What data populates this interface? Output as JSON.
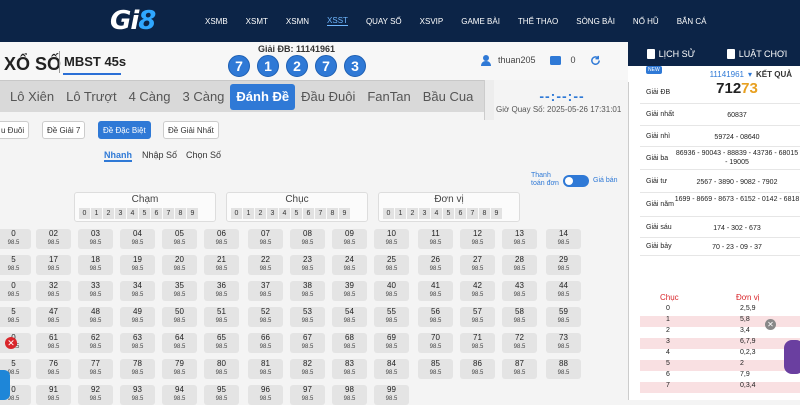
{
  "header": {
    "logo": "Gi8",
    "nav": [
      "XSMB",
      "XSMT",
      "XSMN",
      "XSST",
      "QUAY SỐ",
      "XSVIP",
      "GAME BÀI",
      "THỂ THAO",
      "SÒNG BÀI",
      "NỔ HŨ",
      "BẮN CÁ"
    ],
    "active_nav": "XSST"
  },
  "game": {
    "title": "XỔ SỐ",
    "name": "MBST 45s",
    "special_label": "Giải ĐB: 11141961",
    "balls": [
      "7",
      "1",
      "2",
      "7",
      "3"
    ],
    "user": "thuan205",
    "balance": "0"
  },
  "tabs": [
    "Lô Xiên",
    "Lô Trượt",
    "4 Càng",
    "3 Càng",
    "Đánh Đề",
    "Đầu Đuôi",
    "FanTan",
    "Bầu Cua"
  ],
  "active_tab": "Đánh Đề",
  "timer": "--:--:--",
  "draw_time": "Giờ Quay Số: 2025-05-26 17:31:01",
  "sub_tabs": [
    "u Đuôi",
    "Đề Giải 7",
    "Đề Đặc Biệt",
    "Đề Giải Nhất"
  ],
  "modes": [
    "Nhanh",
    "Nhập Số",
    "Chọn Số"
  ],
  "toggle": {
    "left": "Thanh toán đơn",
    "right": "Giá bán"
  },
  "digit_groups": [
    {
      "title": "Chạm",
      "digits": [
        "0",
        "1",
        "2",
        "3",
        "4",
        "5",
        "6",
        "7",
        "8",
        "9"
      ]
    },
    {
      "title": "Chục",
      "digits": [
        "0",
        "1",
        "2",
        "3",
        "4",
        "5",
        "6",
        "7",
        "8",
        "9"
      ]
    },
    {
      "title": "Đơn vị",
      "digits": [
        "0",
        "1",
        "2",
        "3",
        "4",
        "5",
        "6",
        "7",
        "8",
        "9"
      ]
    }
  ],
  "odds": "98.5",
  "grid_rows": [
    [
      "0",
      "02",
      "03",
      "04",
      "05",
      "06",
      "07",
      "08",
      "09",
      "10",
      "11",
      "12",
      "13",
      "14"
    ],
    [
      "5",
      "17",
      "18",
      "19",
      "20",
      "21",
      "22",
      "23",
      "24",
      "25",
      "26",
      "27",
      "28",
      "29"
    ],
    [
      "0",
      "32",
      "33",
      "34",
      "35",
      "36",
      "37",
      "38",
      "39",
      "40",
      "41",
      "42",
      "43",
      "44"
    ],
    [
      "5",
      "47",
      "48",
      "49",
      "50",
      "51",
      "52",
      "53",
      "54",
      "55",
      "56",
      "57",
      "58",
      "59"
    ],
    [
      "0",
      "61",
      "62",
      "63",
      "64",
      "65",
      "66",
      "67",
      "68",
      "69",
      "70",
      "71",
      "72",
      "73"
    ],
    [
      "5",
      "76",
      "77",
      "78",
      "79",
      "80",
      "81",
      "82",
      "83",
      "84",
      "85",
      "86",
      "87",
      "88"
    ],
    [
      "0",
      "91",
      "92",
      "93",
      "94",
      "95",
      "96",
      "97",
      "98",
      "99"
    ]
  ],
  "right": {
    "tabs": [
      "LỊCH SỬ",
      "LUẬT CHƠI"
    ],
    "new": "NEW",
    "period": "11141961",
    "result_label": "KẾT QUẢ",
    "prizes": [
      {
        "label": "Giải ĐB",
        "value": "71273"
      },
      {
        "label": "Giải nhất",
        "value": "60837"
      },
      {
        "label": "Giải nhì",
        "value": "59724 - 08640"
      },
      {
        "label": "Giải ba",
        "value": "86936 - 90043 - 88839 - 43736 - 68015 - 19005"
      },
      {
        "label": "Giải tư",
        "value": "2567 - 3890 - 9082 - 7902"
      },
      {
        "label": "Giải năm",
        "value": "1699 - 8669 - 8673 - 6152 - 0142 - 6818"
      },
      {
        "label": "Giải sáu",
        "value": "174 - 302 - 673"
      },
      {
        "label": "Giải bảy",
        "value": "70 - 23 - 09 - 37"
      }
    ],
    "table_headers": [
      "Chục",
      "Đơn vị"
    ],
    "table_rows": [
      [
        "0",
        "2,5,9"
      ],
      [
        "1",
        "5,8"
      ],
      [
        "2",
        "3,4"
      ],
      [
        "3",
        "6,7,9"
      ],
      [
        "4",
        "0,2,3"
      ],
      [
        "5",
        "2"
      ],
      [
        "6",
        "7,9"
      ],
      [
        "7",
        "0,3,4"
      ]
    ]
  }
}
